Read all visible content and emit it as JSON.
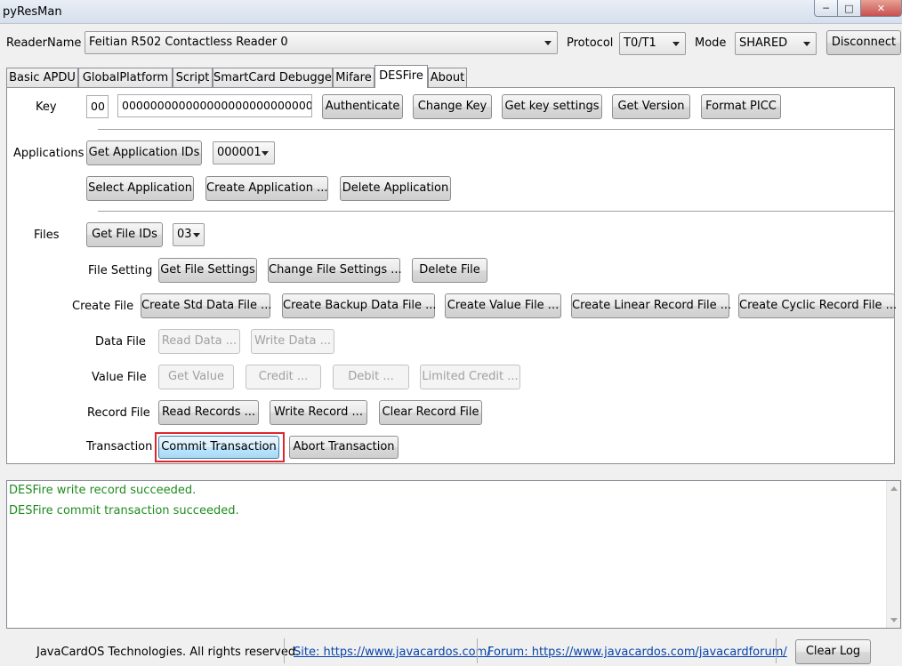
{
  "window": {
    "title": "pyResMan"
  },
  "topbar": {
    "reader_label": "ReaderName",
    "reader_value": "Feitian R502 Contactless Reader 0",
    "protocol_label": "Protocol",
    "protocol_value": "T0/T1",
    "mode_label": "Mode",
    "mode_value": "SHARED",
    "disconnect_label": "Disconnect"
  },
  "tabs": [
    "Basic APDU",
    "GlobalPlatform",
    "Script",
    "SmartCard Debugger",
    "Mifare",
    "DESFire",
    "About"
  ],
  "active_tab": "DESFire",
  "key_section": {
    "label": "Key",
    "key_no": "00",
    "key_value": "00000000000000000000000000000000",
    "authenticate": "Authenticate",
    "change_key": "Change Key",
    "get_key_settings": "Get key settings",
    "get_version": "Get Version",
    "format_picc": "Format PICC"
  },
  "applications": {
    "label": "Applications",
    "get_ids": "Get Application IDs",
    "selected_id": "000001",
    "select": "Select Application",
    "create": "Create Application ...",
    "delete": "Delete Application"
  },
  "files": {
    "label": "Files",
    "get_ids": "Get File IDs",
    "selected_id": "03",
    "file_setting_label": "File Setting",
    "get_settings": "Get File Settings",
    "change_settings": "Change File Settings ...",
    "delete_file": "Delete File",
    "create_file_label": "Create File",
    "create_std": "Create Std Data File ...",
    "create_backup": "Create Backup Data File ...",
    "create_value": "Create Value File ...",
    "create_linear": "Create Linear Record File ...",
    "create_cyclic": "Create Cyclic Record File ...",
    "data_file_label": "Data File",
    "read_data": "Read Data ...",
    "write_data": "Write Data ...",
    "value_file_label": "Value File",
    "get_value": "Get Value",
    "credit": "Credit ...",
    "debit": "Debit ...",
    "limited_credit": "Limited Credit ...",
    "record_file_label": "Record File",
    "read_records": "Read Records ...",
    "write_record": "Write Record ...",
    "clear_record": "Clear Record File",
    "transaction_label": "Transaction",
    "commit": "Commit Transaction",
    "abort": "Abort Transaction"
  },
  "log": {
    "lines": [
      "DESFire write record succeeded.",
      "DESFire commit transaction succeeded."
    ],
    "color": "#1f8c1f"
  },
  "footer": {
    "copyright": "JavaCardOS Technologies. All rights reserved.",
    "site_link": "Site: https://www.javacardos.com/",
    "forum_link": "Forum: https://www.javacardos.com/javacardforum/",
    "clear_log": "Clear Log"
  },
  "accent": {
    "highlight": "#e0262b",
    "link": "#0645ad"
  }
}
